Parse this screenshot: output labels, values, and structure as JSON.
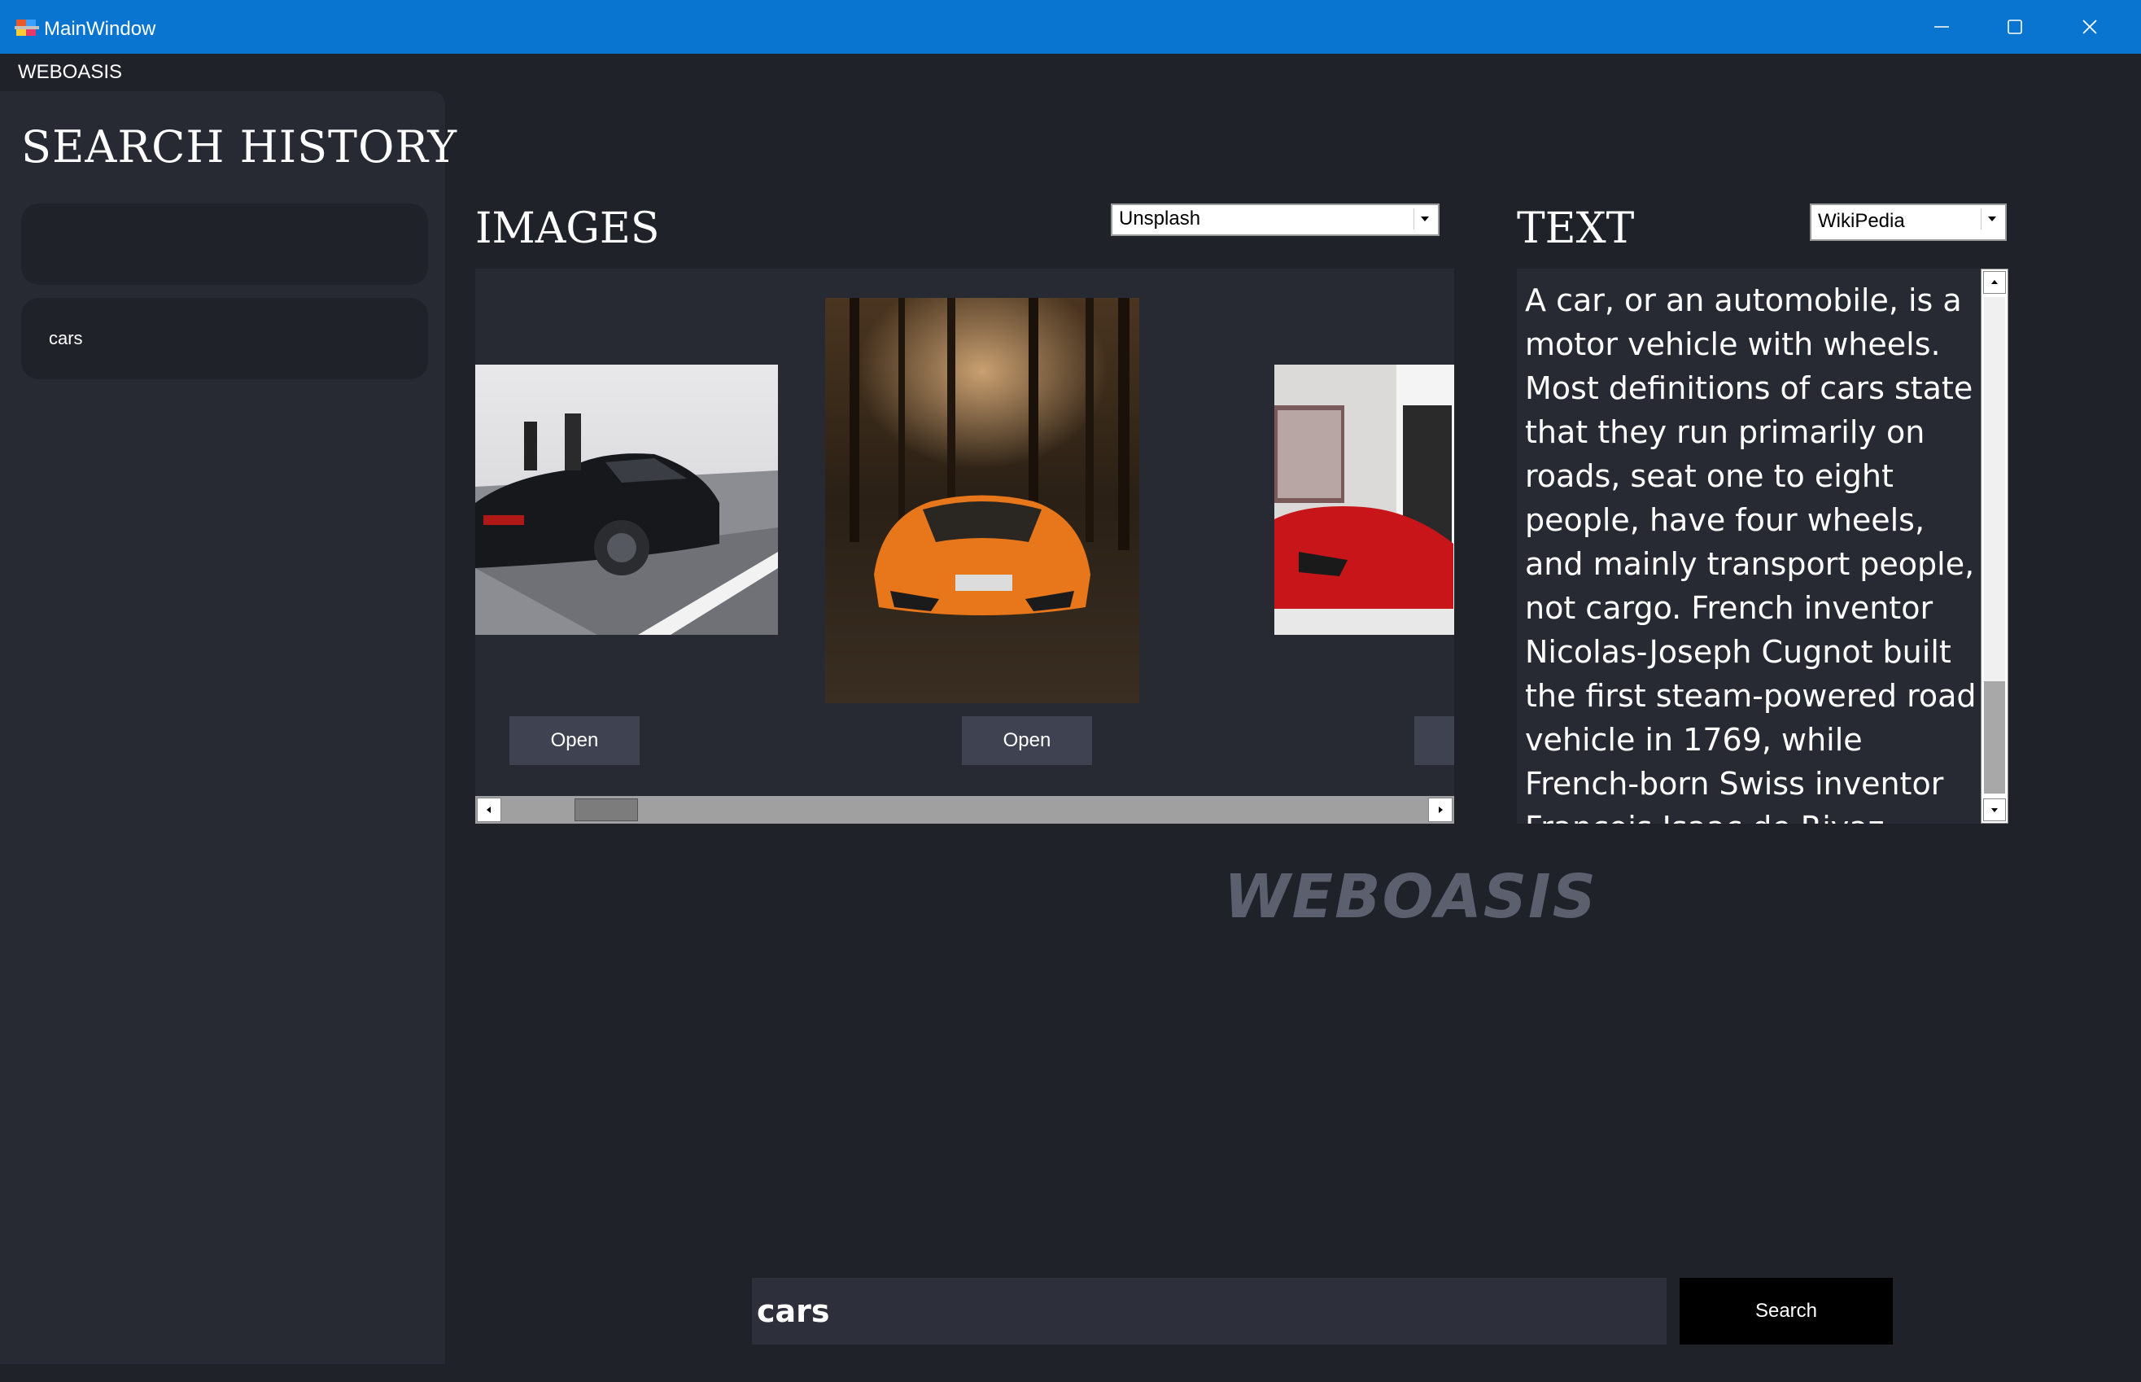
{
  "window": {
    "title": "MainWindow",
    "controls": [
      "minimize-icon",
      "maximize-icon",
      "close-icon"
    ]
  },
  "menubar": {
    "item": "WEBOASIS"
  },
  "sidebar": {
    "title": "SEARCH HISTORY",
    "items": [
      {
        "label": ""
      },
      {
        "label": "cars"
      }
    ]
  },
  "images": {
    "title": "IMAGES",
    "source_selected": "Unsplash",
    "open_label": "Open",
    "cards": [
      {
        "icon": "black-sports-car-image"
      },
      {
        "icon": "orange-supercar-image"
      },
      {
        "icon": "red-sports-car-image"
      }
    ]
  },
  "text": {
    "title": "TEXT",
    "source_selected": "WikiPedia",
    "content": "A car, or an automobile, is a motor vehicle with wheels. Most definitions of cars state that they run primarily on roads, seat one to eight people, have four wheels, and mainly transport people, not cargo. French inventor Nicolas-Joseph Cugnot built the first steam-powered road vehicle in 1769, while French-born Swiss inventor François Isaac de Rivaz designed and"
  },
  "logo": "WEBOASIS",
  "search": {
    "value": "cars",
    "button_label": "Search"
  },
  "colors": {
    "titlebar": "#0a75d0",
    "background": "#1f2229",
    "panel": "#272a33",
    "button": "#3f4250",
    "logo": "#5c5f6e"
  }
}
